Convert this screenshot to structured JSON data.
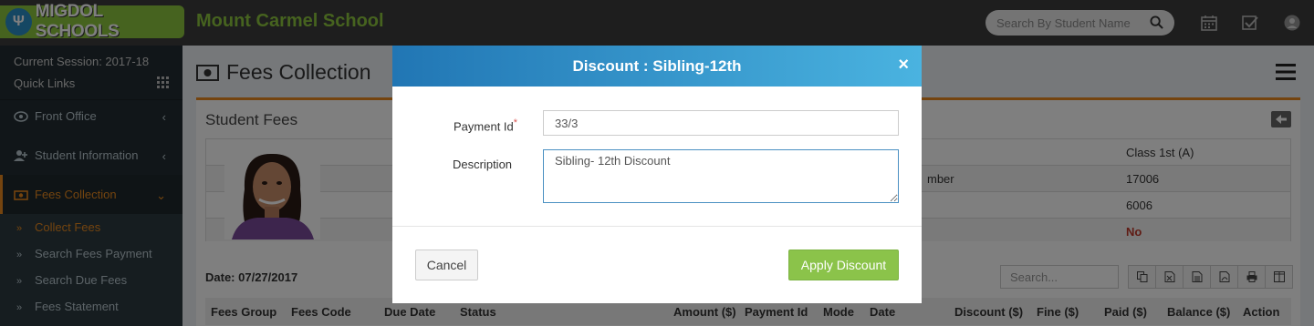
{
  "header": {
    "logo_text": "MIGDOL SCHOOLS",
    "school_name": "Mount Carmel School",
    "search_placeholder": "Search By Student Name"
  },
  "sidebar": {
    "session": "Current Session: 2017-18",
    "quick_links": "Quick Links",
    "items": [
      {
        "label": "Front Office",
        "icon": "building-icon"
      },
      {
        "label": "Student Information",
        "icon": "user-plus-icon"
      },
      {
        "label": "Fees Collection",
        "icon": "money-icon"
      }
    ],
    "submenu": [
      {
        "label": "Collect Fees"
      },
      {
        "label": "Search Fees Payment"
      },
      {
        "label": "Search Due Fees"
      },
      {
        "label": "Fees Statement"
      }
    ]
  },
  "page": {
    "title": "Fees Collection",
    "box_title": "Student Fees",
    "student_rows": [
      {
        "label": "",
        "value": "Class 1st (A)"
      },
      {
        "label": "mber",
        "value": "17006"
      },
      {
        "label": "",
        "value": "6006"
      },
      {
        "label": "",
        "value": "No"
      }
    ],
    "date": "Date: 07/27/2017",
    "search_placeholder": "Search...",
    "columns": [
      "Fees Group",
      "Fees Code",
      "Due Date",
      "Status",
      "Amount ($)",
      "Payment Id",
      "Mode",
      "Date",
      "Discount ($)",
      "Fine ($)",
      "Paid ($)",
      "Balance ($)",
      "Action"
    ],
    "toolbar_icons": [
      "copy-icon",
      "excel-icon",
      "csv-icon",
      "pdf-icon",
      "print-icon",
      "columns-icon"
    ]
  },
  "modal": {
    "title": "Discount : Sibling-12th",
    "close": "×",
    "payment_id_label": "Payment Id",
    "required_mark": "*",
    "payment_id_value": "33/3",
    "description_label": "Description",
    "description_value": "Sibling- 12th Discount",
    "cancel_label": "Cancel",
    "apply_label": "Apply Discount"
  },
  "colors": {
    "brand_green": "#8dc63f",
    "accent_orange": "#e8891f",
    "apply_green": "#8bc34a",
    "modal_header_start": "#2176b4",
    "modal_header_end": "#4ab3e0"
  }
}
